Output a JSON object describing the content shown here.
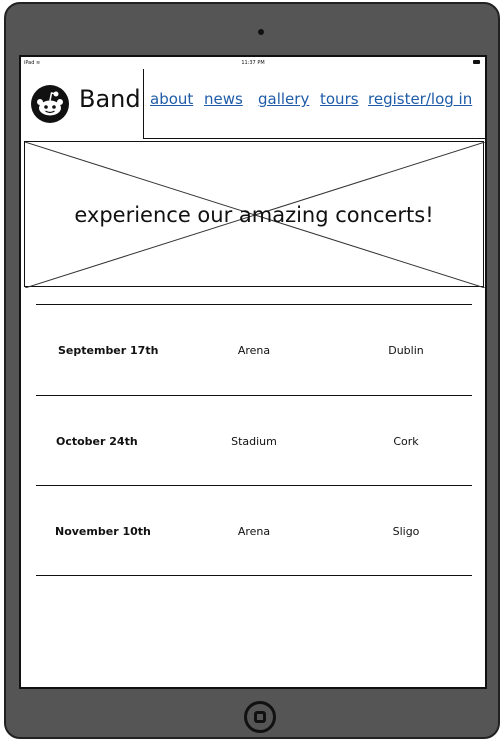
{
  "status": {
    "left": "iPad",
    "time": "11:37 PM"
  },
  "header": {
    "brand": "Band",
    "nav": {
      "about": "about",
      "news": "news",
      "gallery": "gallery",
      "tours": "tours",
      "register": "register/log in"
    }
  },
  "hero": {
    "text": "experience our amazing concerts!"
  },
  "concerts": [
    {
      "date": "September 17th",
      "venue": "Arena",
      "city": "Dublin"
    },
    {
      "date": "October 24th",
      "venue": "Stadium",
      "city": "Cork"
    },
    {
      "date": "November 10th",
      "venue": "Arena",
      "city": "Sligo"
    }
  ]
}
